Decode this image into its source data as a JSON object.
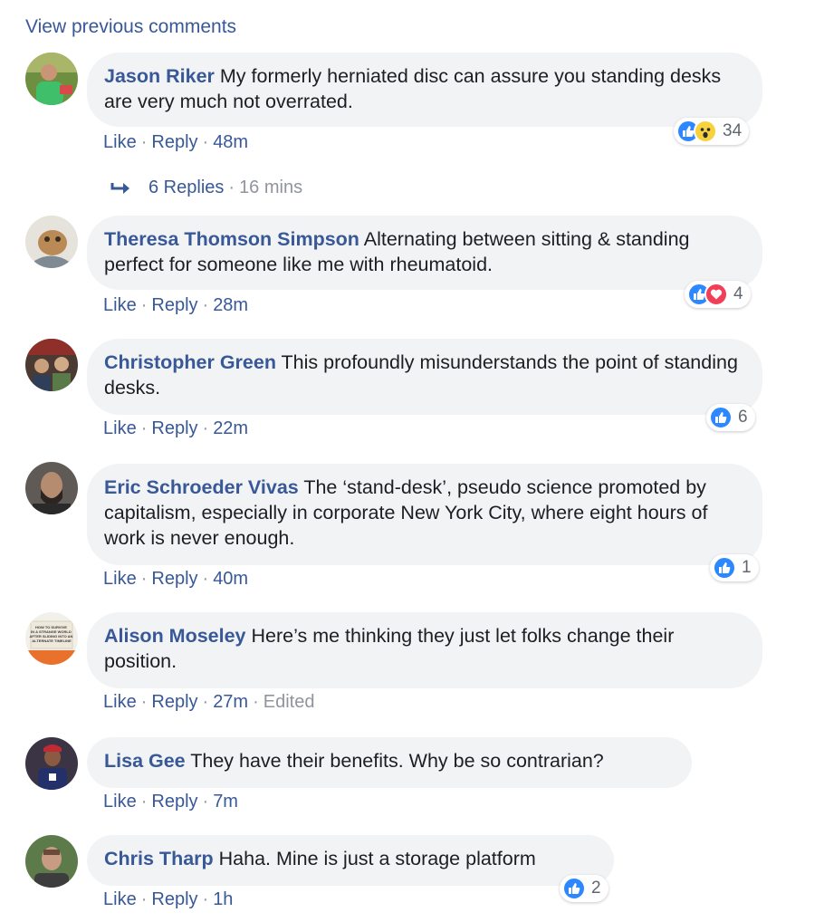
{
  "view_previous": "View previous comments",
  "actions": {
    "like": "Like",
    "reply": "Reply",
    "dot": "·"
  },
  "comments": [
    {
      "author": "Jason Riker",
      "text": "My formerly herniated disc can assure you standing desks are very much not overrated.",
      "time": "48m",
      "reaction_count": "34",
      "reactions": [
        "like",
        "wow"
      ],
      "replies": {
        "label": "6 Replies",
        "time": "16 mins"
      }
    },
    {
      "author": "Theresa Thomson Simpson",
      "text": "Alternating between sitting & standing perfect for someone like me with rheumatoid.",
      "time": "28m",
      "reaction_count": "4",
      "reactions": [
        "like",
        "love"
      ]
    },
    {
      "author": "Christopher Green",
      "text": "This profoundly misunderstands the point of standing desks.",
      "time": "22m",
      "reaction_count": "6",
      "reactions": [
        "like"
      ]
    },
    {
      "author": "Eric Schroeder Vivas",
      "text": "The ‘stand-desk’, pseudo science promoted by capitalism, especially in corporate New York City, where eight hours of work is never enough.",
      "time": "40m",
      "reaction_count": "1",
      "reactions": [
        "like"
      ]
    },
    {
      "author": "Alison Moseley",
      "text": "Here’s me thinking they just let folks change their position.",
      "time": "27m",
      "edited": "Edited",
      "avatar_text": "HOW TO SURVIVE IN A STRANGE WORLD AFTER SLIDING INTO AN ALTERNATE TIMELINE"
    },
    {
      "author": "Lisa Gee",
      "text": "They have their benefits. Why be so contrarian?",
      "time": "7m"
    },
    {
      "author": "Chris Tharp",
      "text": "Haha. Mine is just a storage platform",
      "time": "1h",
      "reaction_count": "2",
      "reactions": [
        "like"
      ]
    }
  ],
  "colors": {
    "link": "#385898",
    "bubble": "#f2f3f5",
    "meta": "#90949c",
    "like": "#2d88ff",
    "love": "#f33e58",
    "wow": "#f7d23c"
  }
}
